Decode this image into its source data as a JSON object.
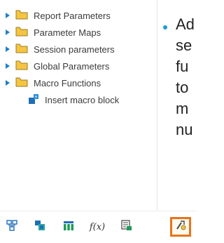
{
  "tree": {
    "items": [
      {
        "label": "Report Parameters",
        "icon": "folder-icon",
        "expander": "triangle-right-icon"
      },
      {
        "label": "Parameter Maps",
        "icon": "folder-icon",
        "expander": "triangle-right-icon"
      },
      {
        "label": "Session parameters",
        "icon": "folder-icon",
        "expander": "triangle-right-icon"
      },
      {
        "label": "Global Parameters",
        "icon": "folder-icon",
        "expander": "triangle-right-icon"
      },
      {
        "label": "Macro Functions",
        "icon": "folder-icon",
        "expander": "triangle-right-icon"
      }
    ],
    "insert_macro_block": {
      "label": "Insert macro block",
      "icon": "insert-macro-block-icon"
    }
  },
  "toolbar": {
    "buttons": [
      {
        "icon": "data-items-icon"
      },
      {
        "icon": "toolbox-icon"
      },
      {
        "icon": "query-calculation-icon"
      },
      {
        "icon": "function-icon"
      },
      {
        "icon": "parameters-icon"
      },
      {
        "icon": "macro-icon",
        "active": true
      }
    ]
  },
  "slide_text": {
    "lines": [
      "Ad",
      "se",
      "fu",
      "to",
      "m",
      "nu"
    ]
  },
  "colors": {
    "folder": "#f5c542",
    "expander": "#1f7fc8",
    "accent": "#e8741b",
    "bullet": "#1f9ad6"
  }
}
